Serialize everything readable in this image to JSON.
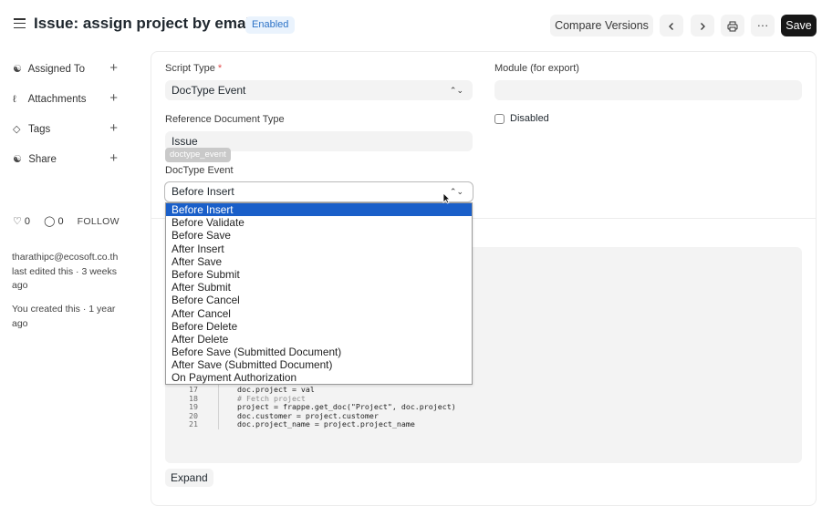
{
  "header": {
    "title": "Issue: assign project by email",
    "status_badge": "Enabled",
    "compare_versions": "Compare Versions",
    "save": "Save",
    "more": "···"
  },
  "sidebar": {
    "items": [
      {
        "label": "Assigned To",
        "icon": "assign-icon"
      },
      {
        "label": "Attachments",
        "icon": "paperclip-icon"
      },
      {
        "label": "Tags",
        "icon": "tag-icon"
      },
      {
        "label": "Share",
        "icon": "share-icon"
      }
    ],
    "likes": "0",
    "comments": "0",
    "follow": "FOLLOW",
    "last_edited": "tharathipc@ecosoft.co.th last edited this · 3 weeks ago",
    "created": "You created this · 1 year ago"
  },
  "form": {
    "script_type": {
      "label": "Script Type",
      "required": "*",
      "value": "DocType Event"
    },
    "module": {
      "label": "Module (for export)",
      "value": ""
    },
    "reference_doctype": {
      "label": "Reference Document Type",
      "value": "Issue"
    },
    "disabled": {
      "label": "Disabled",
      "checked": false
    },
    "doctype_event": {
      "label": "DocType Event",
      "value": "Before Insert",
      "tag": "doctype_event"
    },
    "expand": "Expand"
  },
  "dropdown": {
    "options": [
      "Before Insert",
      "Before Validate",
      "Before Save",
      "After Insert",
      "After Save",
      "Before Submit",
      "After Submit",
      "Before Cancel",
      "After Cancel",
      "Before Delete",
      "After Delete",
      "Before Save (Submitted Document)",
      "After Save (Submitted Document)",
      "On Payment Authorization"
    ],
    "selected_index": 0
  },
  "code": {
    "line_numbers": [
      "17",
      "18",
      "19",
      "20",
      "21"
    ],
    "lines": [
      "doc.project = val",
      "# Fetch project",
      "project = frappe.get_doc(\"Project\", doc.project)",
      "doc.customer = project.customer",
      "doc.project_name = project.project_name"
    ]
  }
}
